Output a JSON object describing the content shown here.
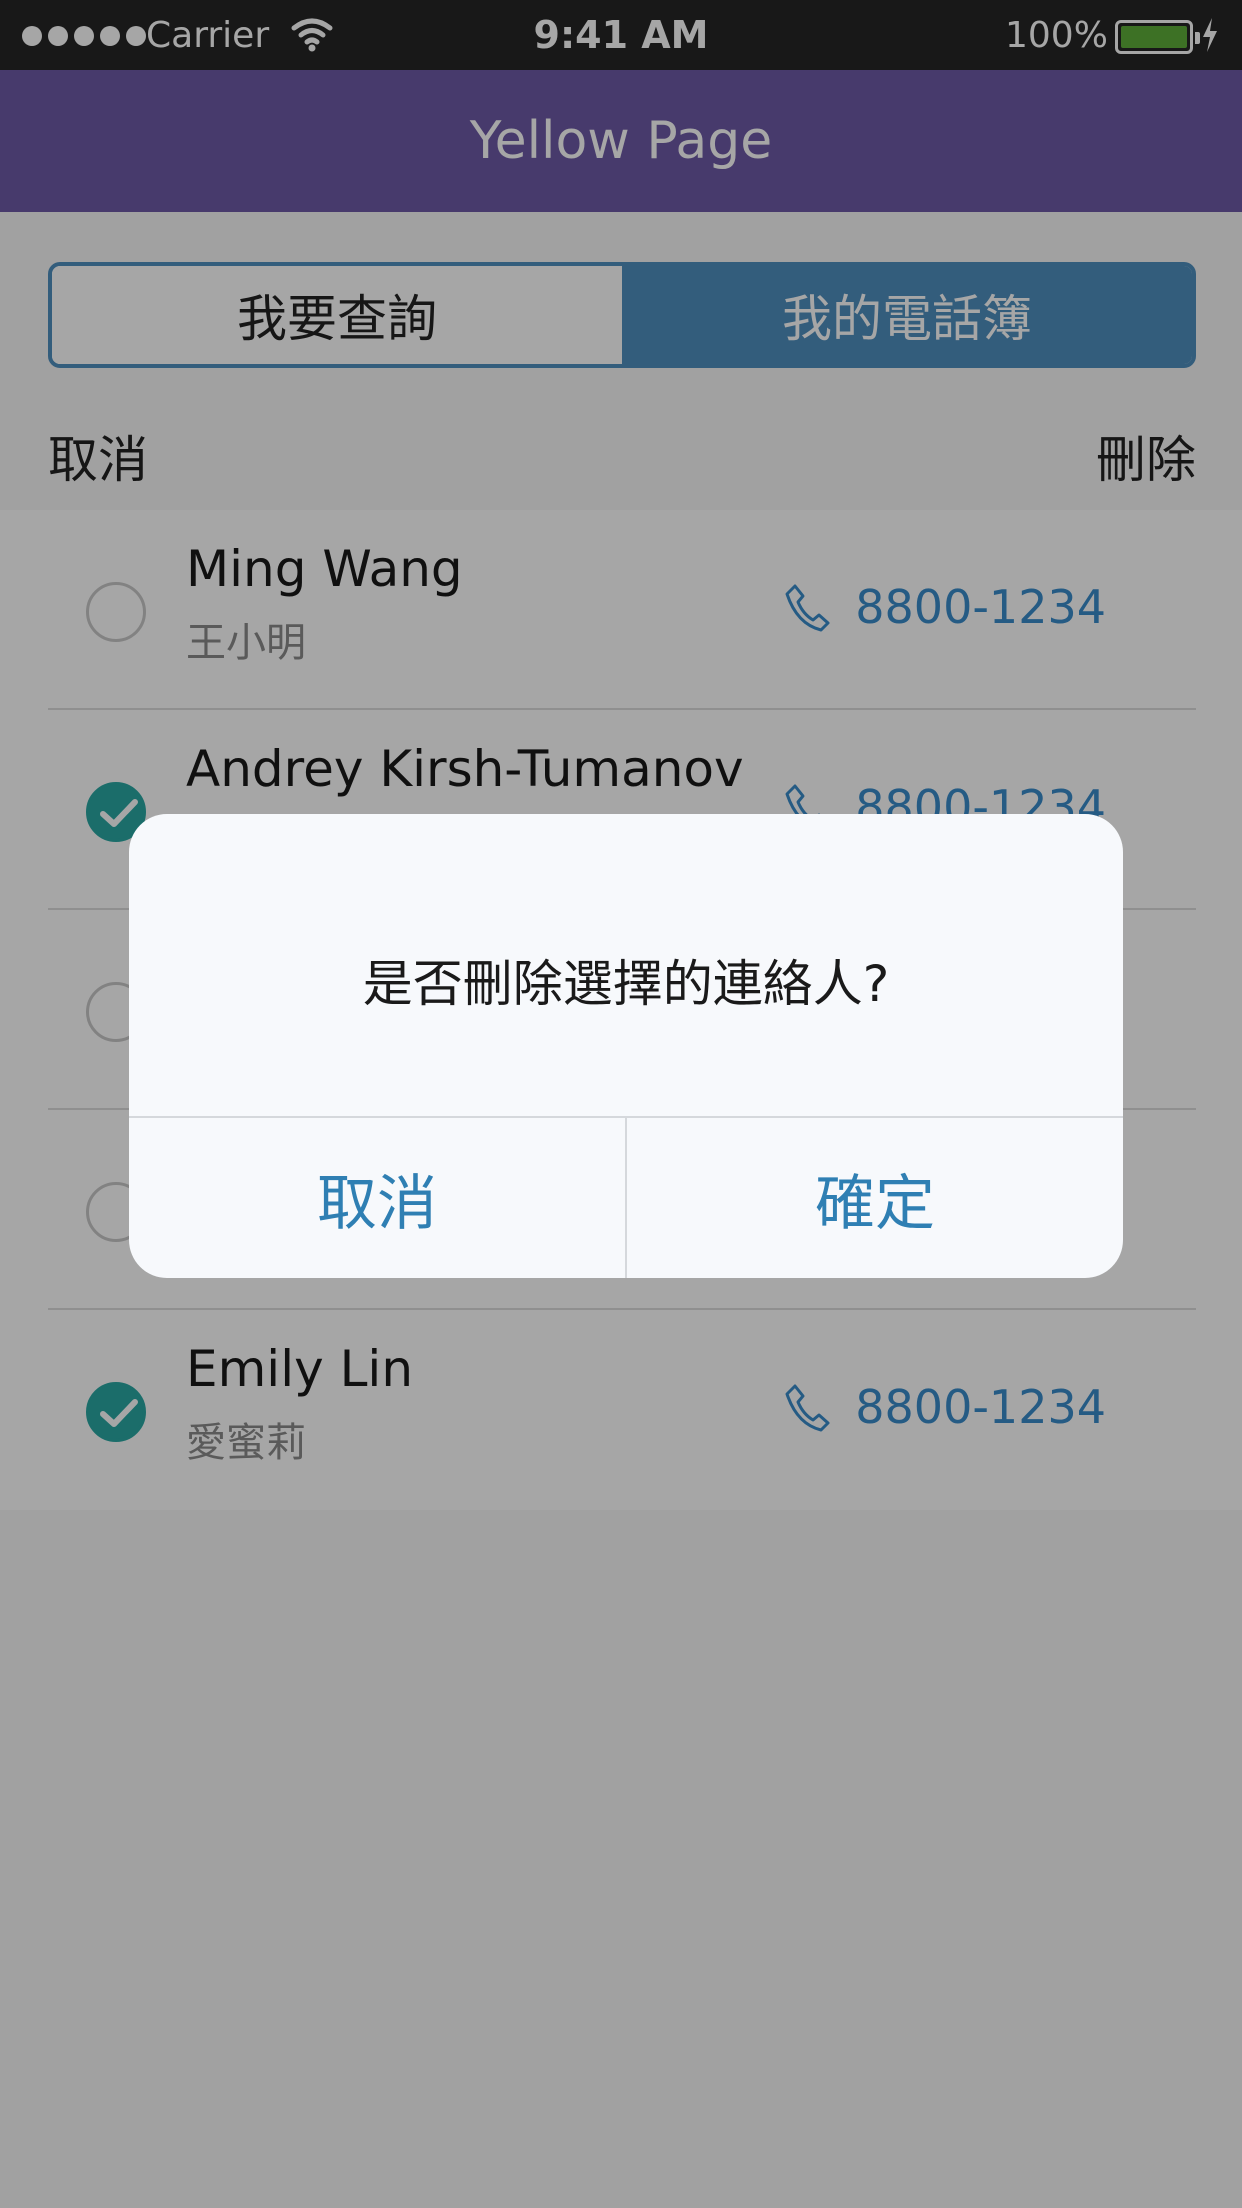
{
  "status_bar": {
    "carrier": "Carrier",
    "time": "9:41 AM",
    "battery": "100%"
  },
  "navbar": {
    "title": "Yellow Page"
  },
  "segment": {
    "tabs": [
      {
        "label": "我要查詢",
        "selected": false
      },
      {
        "label": "我的電話簿",
        "selected": true
      }
    ]
  },
  "edit_bar": {
    "cancel_label": "取消",
    "delete_label": "刪除"
  },
  "contacts": [
    {
      "name": "Ming Wang",
      "chinese_name": "王小明",
      "phone": "8800-1234",
      "checked": false
    },
    {
      "name": "Andrey Kirsh-Tumanov",
      "chinese_name": "",
      "phone": "8800-1234",
      "checked": true
    },
    {
      "name": "",
      "chinese_name": "",
      "phone": "",
      "checked": false
    },
    {
      "name": "",
      "chinese_name": "",
      "phone": "",
      "checked": false
    },
    {
      "name": "Emily Lin",
      "chinese_name": "愛蜜莉",
      "phone": "8800-1234",
      "checked": true
    }
  ],
  "dialog": {
    "message": "是否刪除選擇的連絡人?",
    "cancel_label": "取消",
    "confirm_label": "確定"
  },
  "colors": {
    "navbar": "#6e5aa6",
    "accent_blue": "#4f8fbf",
    "check_teal": "#2aa8a4",
    "phone_blue": "#3a8ccb",
    "dialog_button": "#2f7fb3"
  }
}
